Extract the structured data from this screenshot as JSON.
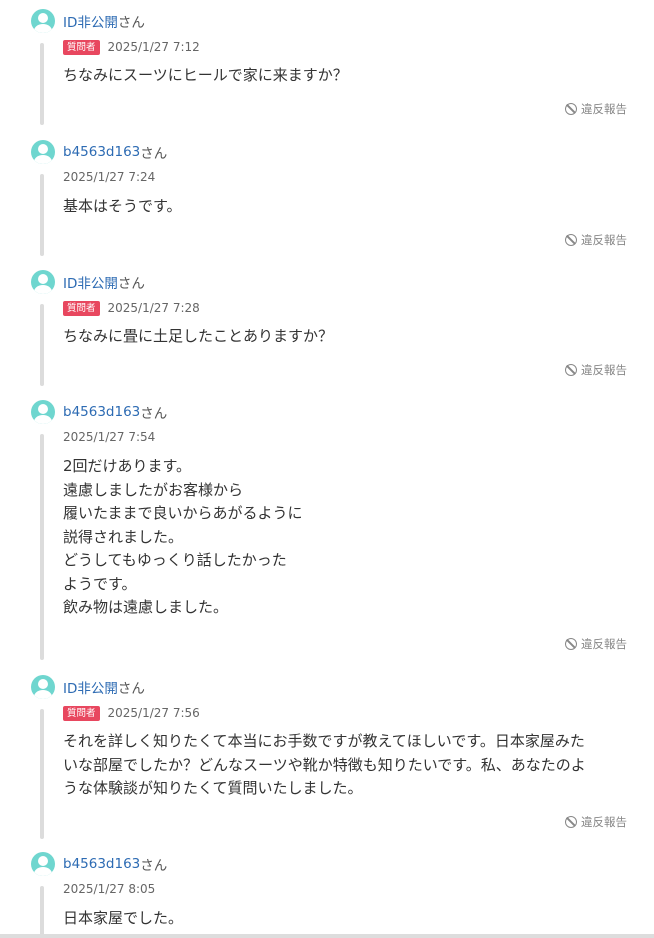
{
  "suffix": "さん",
  "report_label": "違反報告",
  "questioner_badge": "質問者",
  "colors": {
    "username": "#2d6bb3",
    "badge": "#e8475f",
    "avatar": "#6fd6cf",
    "thread_line": "#dcdcdc"
  },
  "comments": [
    {
      "user": "ID非公開",
      "is_questioner": true,
      "timestamp": "2025/1/27 7:12",
      "lines": [
        "ちなみにスーツにヒールで家に来ますか？"
      ]
    },
    {
      "user": "b4563d163",
      "is_questioner": false,
      "timestamp": "2025/1/27 7:24",
      "lines": [
        "基本はそうです。"
      ]
    },
    {
      "user": "ID非公開",
      "is_questioner": true,
      "timestamp": "2025/1/27 7:28",
      "lines": [
        "ちなみに畳に土足したことありますか？"
      ]
    },
    {
      "user": "b4563d163",
      "is_questioner": false,
      "timestamp": "2025/1/27 7:54",
      "lines": [
        "2回だけあります。",
        "遠慮しましたがお客様から",
        "履いたままで良いからあがるように",
        "説得されました。",
        "どうしてもゆっくり話したかった",
        "ようです。",
        "飲み物は遠慮しました。"
      ]
    },
    {
      "user": "ID非公開",
      "is_questioner": true,
      "timestamp": "2025/1/27 7:56",
      "lines": [
        "それを詳しく知りたくて本当にお手数ですが教えてほしいです。日本家屋みた",
        "いな部屋でしたか？どんなスーツや靴か特徴も知りたいです。私、あなたのよ",
        "うな体験談が知りたくて質問いたしました。"
      ]
    },
    {
      "user": "b4563d163",
      "is_questioner": false,
      "timestamp": "2025/1/27 8:05",
      "lines": [
        "日本家屋でした。"
      ]
    }
  ]
}
